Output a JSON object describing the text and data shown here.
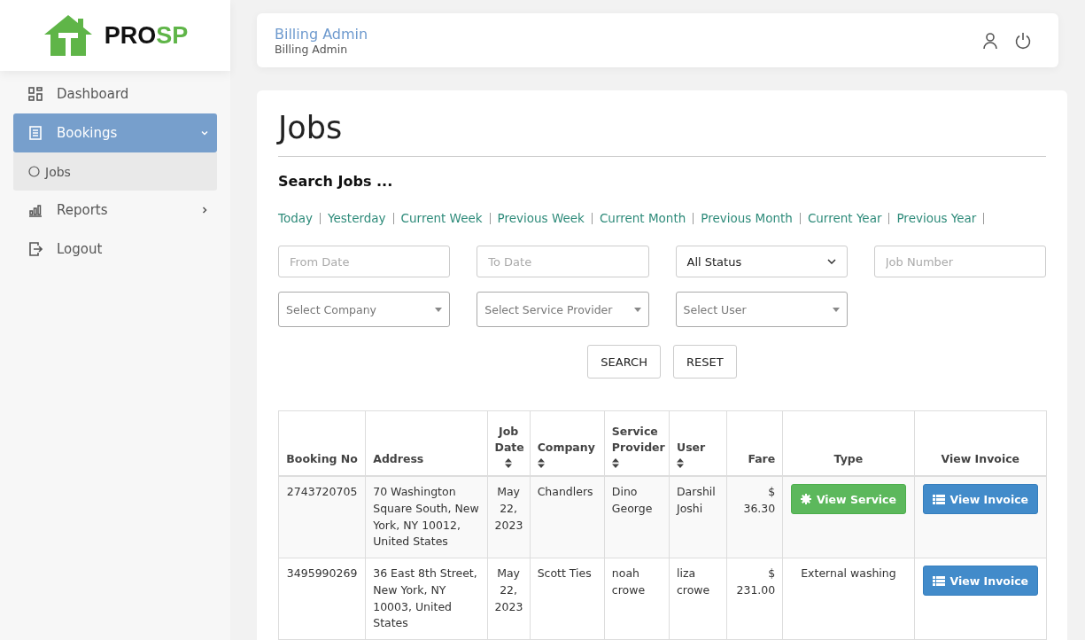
{
  "logo": {
    "text_dark": "PRO",
    "text_accent": "SP"
  },
  "sidebar": {
    "items": [
      {
        "label": "Dashboard",
        "selected": false
      },
      {
        "label": "Bookings",
        "selected": true,
        "expanded": true,
        "children": [
          {
            "label": "Jobs",
            "selected": true
          }
        ]
      },
      {
        "label": "Reports",
        "selected": false,
        "expanded": false
      },
      {
        "label": "Logout",
        "selected": false
      }
    ]
  },
  "header": {
    "title": "Billing Admin",
    "subtitle": "Billing Admin"
  },
  "page": {
    "title": "Jobs",
    "search_heading": "Search Jobs ...",
    "quick_filters": [
      "Today",
      "Yesterday",
      "Current Week",
      "Previous Week",
      "Current Month",
      "Previous Month",
      "Current Year",
      "Previous Year"
    ],
    "filters": [
      {
        "kind": "input",
        "placeholder": "From Date"
      },
      {
        "kind": "input",
        "placeholder": "To Date"
      },
      {
        "kind": "select",
        "value": "All Status"
      },
      {
        "kind": "input",
        "placeholder": "Job Number"
      },
      {
        "kind": "combo",
        "placeholder": "Select Company"
      },
      {
        "kind": "combo",
        "placeholder": "Select Service Provider"
      },
      {
        "kind": "combo",
        "placeholder": "Select User"
      }
    ],
    "buttons": [
      "SEARCH",
      "RESET"
    ]
  },
  "table": {
    "columns": [
      {
        "label": "Booking No",
        "sortable": false
      },
      {
        "label": "Address",
        "sortable": false
      },
      {
        "label": "Job Date",
        "sortable": true
      },
      {
        "label": "Company",
        "sortable": true
      },
      {
        "label": "Service Provider",
        "sortable": true
      },
      {
        "label": "User",
        "sortable": true
      },
      {
        "label": "Fare",
        "sortable": false
      },
      {
        "label": "Type",
        "sortable": false
      },
      {
        "label": "View Invoice",
        "sortable": false
      }
    ],
    "rows": [
      {
        "booking_no": "2743720705",
        "address": "70 Washington Square South, New York, NY 10012, United States",
        "job_date": "May 22, 2023",
        "company": "Chandlers",
        "service_provider": "Dino George",
        "user": "Darshil Joshi",
        "fare": "$ 36.30",
        "type": {
          "kind": "button",
          "label": "View Service"
        },
        "invoice": "View Invoice"
      },
      {
        "booking_no": "3495990269",
        "address": "36 East 8th Street, New York, NY 10003, United States",
        "job_date": "May 22, 2023",
        "company": "Scott Ties",
        "service_provider": "noah crowe",
        "user": "liza crowe",
        "fare": "$ 231.00",
        "type": {
          "kind": "text",
          "label": "External washing"
        },
        "invoice": "View Invoice"
      }
    ]
  }
}
